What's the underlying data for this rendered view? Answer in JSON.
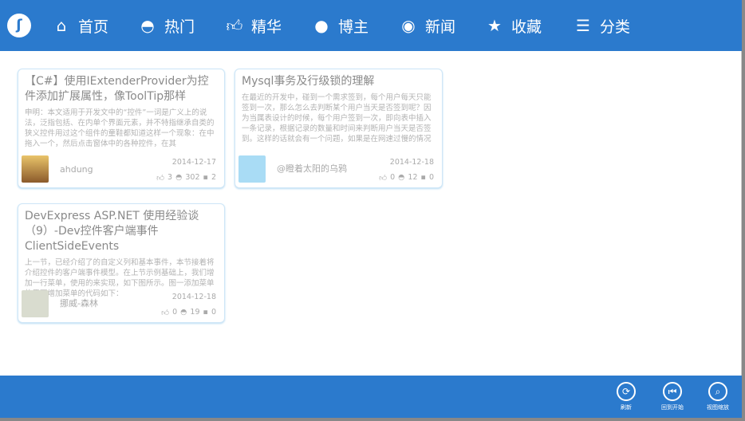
{
  "nav": {
    "logo_icon": "rss-icon",
    "items": [
      {
        "label": "首页",
        "icon": "home-icon"
      },
      {
        "label": "热门",
        "icon": "eye-icon"
      },
      {
        "label": "精华",
        "icon": "thumbs-up-icon"
      },
      {
        "label": "博主",
        "icon": "user-icon"
      },
      {
        "label": "新闻",
        "icon": "globe-icon"
      },
      {
        "label": "收藏",
        "icon": "star-icon"
      },
      {
        "label": "分类",
        "icon": "list-icon"
      }
    ]
  },
  "posts": [
    {
      "title": "【C#】使用IExtenderProvider为控件添加扩展属性，像ToolTip那样",
      "summary": "申明：本文适用于开发文中的“控件”一词是广义上的说法，泛指包括、在内单个界面元素，并不特指继承自类的狭义控件用过这个组件的童鞋都知道这样一个现象：在中拖入一个，然后点击窗体中的各种控件，在其",
      "author": "ahdung",
      "date": "2014-12-17",
      "likes": "3",
      "views": "302",
      "comments": "2"
    },
    {
      "title": "Mysql事务及行级锁的理解",
      "summary": "在最近的开发中，碰到一个需求签到，每个用户每天只能签到一次，那么怎么去判断某个用户当天是否签到呢？因为当属表设计的时候，每个用户签到一次，即向表中插入一条记录，根据记录的数量和时间来判断用户当天是否签到。这样的话就会有一个问题，如果是在网速过慢的情况下，用户...",
      "author": "@瞪着太阳的乌鸦",
      "date": "2014-12-18",
      "likes": "0",
      "views": "12",
      "comments": "0"
    },
    {
      "title": "DevExpress ASP.NET 使用经验谈（9）-Dev控件客户端事件 ClientSideEvents",
      "summary": "上一节，已经介绍了的自定义列和基本事件，本节接着将介绍控件的客户端事件模型。在上节示例基础上，我们增加一行菜单，使用的来实现，如下图所示。图一添加菜单的界面增加菜单的代码如下：",
      "author": "挪威-森林",
      "date": "2014-12-18",
      "likes": "0",
      "views": "19",
      "comments": "0"
    }
  ],
  "appbar": [
    {
      "label": "刷新",
      "icon": "refresh-icon"
    },
    {
      "label": "回到开始",
      "icon": "skip-back-icon"
    },
    {
      "label": "视图缩放",
      "icon": "zoom-icon"
    }
  ],
  "colors": {
    "accent": "#2b7acd"
  }
}
